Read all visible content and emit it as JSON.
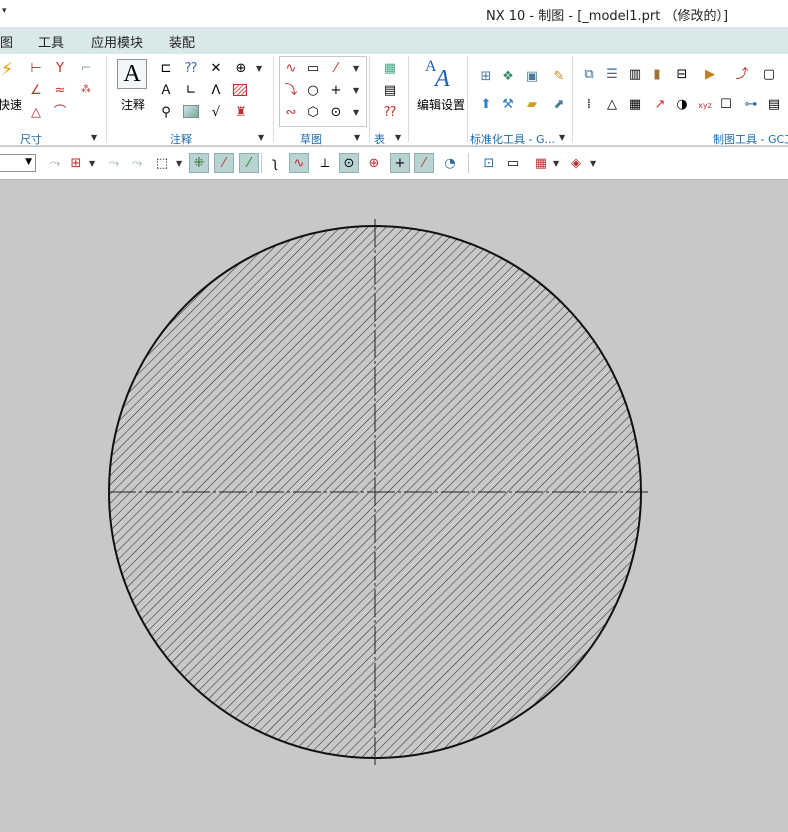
{
  "titlebar": {
    "quick_access_arrow": "▾",
    "title": "NX 10 - 制图 - [_model1.prt （修改的）]"
  },
  "menubar": {
    "items": [
      "图",
      "工具",
      "应用模块",
      "装配"
    ]
  },
  "ribbon": {
    "groups": {
      "dimension": {
        "label": "尺寸",
        "partial_button_label": "快速"
      },
      "annotation": {
        "label": "注释",
        "big_button_label": "注释"
      },
      "sketch": {
        "label": "草图"
      },
      "table": {
        "label": "表"
      },
      "edit_settings": {
        "label": "编辑设置"
      },
      "std_tools": {
        "label": "标准化工具 - G..."
      },
      "drafting_tools": {
        "label": "制图工具 - GC工"
      }
    }
  },
  "selection_bar": {
    "filter_value": ""
  },
  "drawing": {
    "section_view": "circle-hatched",
    "centerlines": true,
    "hatch_color": "#222222",
    "background": "#c8c8c8"
  }
}
